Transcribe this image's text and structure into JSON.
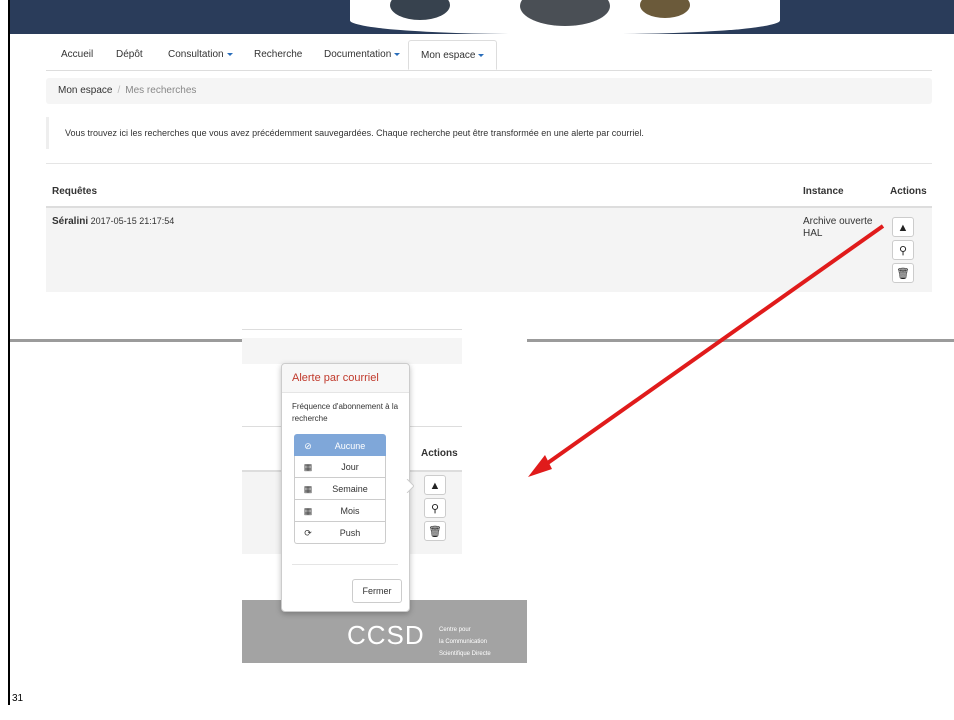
{
  "nav": {
    "tabs": [
      {
        "label": "Accueil"
      },
      {
        "label": "Dépôt"
      },
      {
        "label": "Consultation"
      },
      {
        "label": "Recherche"
      },
      {
        "label": "Documentation"
      },
      {
        "label": "Mon espace"
      }
    ]
  },
  "breadcrumb": {
    "parent": "Mon espace",
    "separator": "/",
    "current": "Mes recherches"
  },
  "info_text": "Vous trouvez ici les recherches que vous avez précédemment sauvegardées. Chaque recherche peut être transformée en une alerte par courriel.",
  "table": {
    "headers": {
      "queries": "Requêtes",
      "instance": "Instance",
      "actions": "Actions"
    },
    "rows": [
      {
        "query": "Séralini",
        "date": "2017-05-15 21:17:54",
        "instance_line1": "Archive ouverte",
        "instance_line2": "HAL"
      }
    ]
  },
  "popover": {
    "title": "Alerte par courriel",
    "label": "Fréquence d'abonnement à la recherche",
    "options": [
      {
        "label": "Aucune",
        "icon": "ban-icon",
        "glyph": "⊘"
      },
      {
        "label": "Jour",
        "icon": "calendar-icon",
        "glyph": "▦"
      },
      {
        "label": "Semaine",
        "icon": "calendar-icon",
        "glyph": "▦"
      },
      {
        "label": "Mois",
        "icon": "calendar-icon",
        "glyph": "▦"
      },
      {
        "label": "Push",
        "icon": "refresh-icon",
        "glyph": "⟳"
      }
    ],
    "selected": "Aucune",
    "close_label": "Fermer"
  },
  "zoomed_actions_header": "Actions",
  "footer": {
    "logo": "CCSD",
    "line1": "Centre pour",
    "line2": "la Communication",
    "line3": "Scientifique Directe"
  },
  "slide_number": "31",
  "colors": {
    "accent": "#2a6ebb",
    "popover_title": "#c0392b",
    "selected_option": "#7fa7d9",
    "arrow": "#e01b1b"
  }
}
